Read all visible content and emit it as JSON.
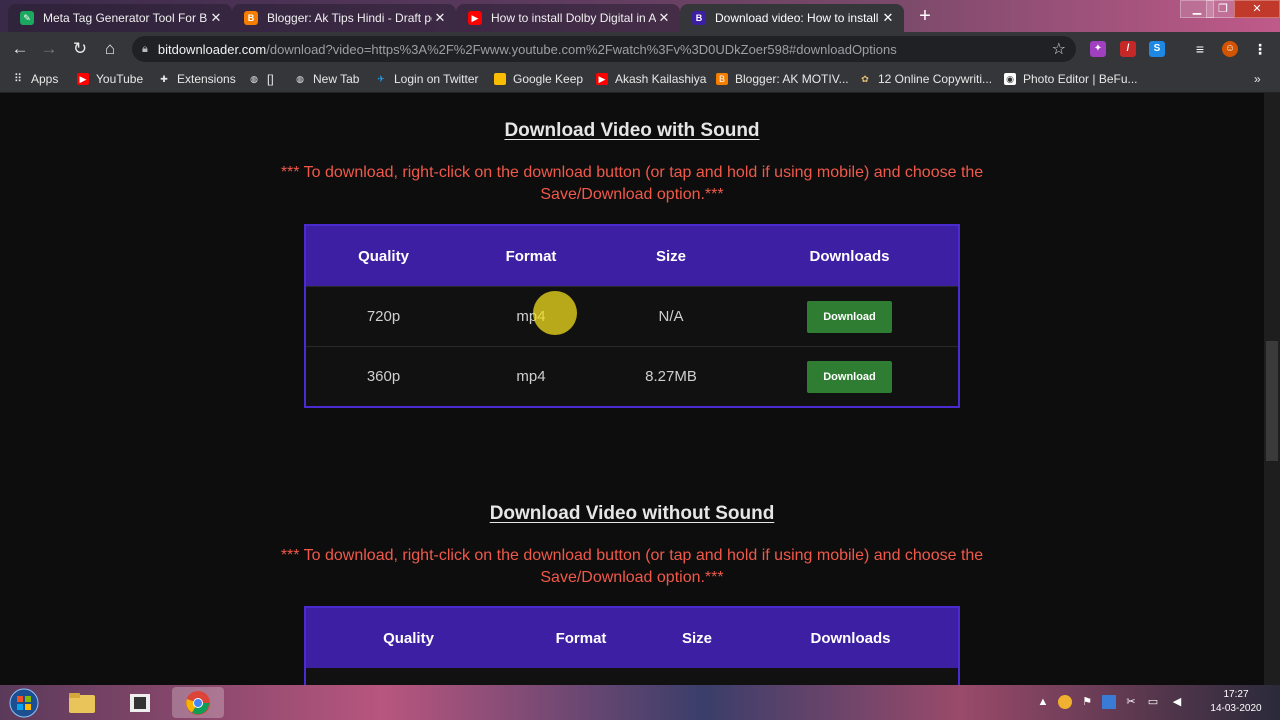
{
  "browser": {
    "tabs": [
      {
        "label": "Meta Tag Generator Tool For Blo",
        "favicon_color": "#1da85f",
        "active": false
      },
      {
        "label": "Blogger: Ak Tips Hindi - Draft po",
        "favicon_color": "#f57d00",
        "active": false
      },
      {
        "label": "How to install Dolby Digital in Ar",
        "favicon_color": "#ff0000",
        "active": false
      },
      {
        "label": "Download video: How to install D",
        "favicon_color": "#3d1fa3",
        "active": true
      }
    ],
    "new_tab_label": "+",
    "url_host": "bitdownloader.com",
    "url_rest": "/download?video=https%3A%2F%2Fwww.youtube.com%2Fwatch%3Fv%3D0UDkZoer598#downloadOptions",
    "bookmarks": [
      {
        "label": "Apps",
        "icon": "grid-icon"
      },
      {
        "label": "YouTube",
        "icon": "youtube-icon"
      },
      {
        "label": "Extensions",
        "icon": "puzzle-icon"
      },
      {
        "label": "[]",
        "icon": "globe-icon"
      },
      {
        "label": "New Tab",
        "icon": "globe-icon"
      },
      {
        "label": "Login on Twitter",
        "icon": "twitter-icon"
      },
      {
        "label": "Google Keep",
        "icon": "keep-icon"
      },
      {
        "label": "Akash Kailashiya",
        "icon": "youtube-icon"
      },
      {
        "label": "Blogger: AK MOTIV...",
        "icon": "blogger-icon"
      },
      {
        "label": "12 Online Copywriti...",
        "icon": "bookmark-icon"
      },
      {
        "label": "Photo Editor | BeFu...",
        "icon": "photo-icon"
      }
    ],
    "bookmarks_overflow": "»"
  },
  "page": {
    "section1": {
      "heading": "Download Video with Sound",
      "note": "*** To download, right-click on the download button (or tap and hold if using mobile) and choose the Save/Download option.***",
      "columns": [
        "Quality",
        "Format",
        "Size",
        "Downloads"
      ],
      "rows": [
        {
          "quality": "720p",
          "format": "mp4",
          "size": "N/A",
          "button": "Download"
        },
        {
          "quality": "360p",
          "format": "mp4",
          "size": "8.27MB",
          "button": "Download"
        }
      ]
    },
    "section2": {
      "heading": "Download Video without Sound",
      "note": "*** To download, right-click on the download button (or tap and hold if using mobile) and choose the Save/Download option.***",
      "columns": [
        "Quality",
        "Format",
        "Size",
        "Downloads"
      ]
    }
  },
  "taskbar": {
    "time": "17:27",
    "date": "14-03-2020"
  },
  "colors": {
    "table_header": "#3d1fa3",
    "table_border": "#4a2bd0",
    "note_text": "#f0594a",
    "download_button": "#2e7d32"
  }
}
